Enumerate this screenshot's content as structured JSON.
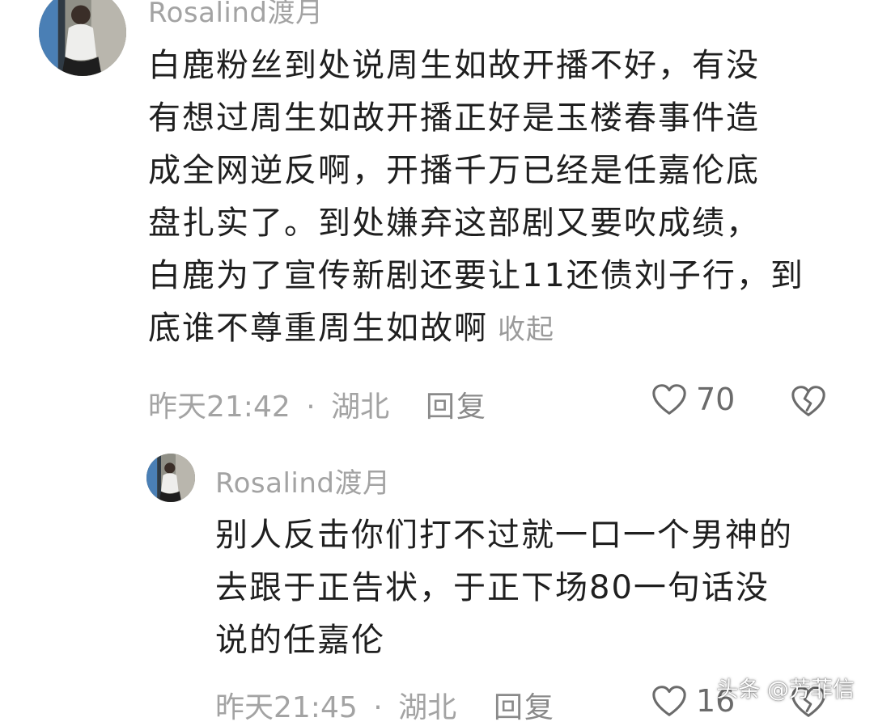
{
  "comments": [
    {
      "username": "Rosalind渡月",
      "lines": [
        "白鹿粉丝到处说周生如故开播不好，有没",
        "有想过周生如故开播正好是玉楼春事件造",
        "成全网逆反啊，开播千万已经是任嘉伦底",
        "盘扎实了。到处嫌弃这部剧又要吹成绩，",
        "白鹿为了宣传新剧还要让11还债刘子行，到",
        "底谁不尊重周生如故啊"
      ],
      "collapse_label": "收起",
      "time": "昨天21:42",
      "separator": "·",
      "location": "湖北",
      "reply_label": "回复",
      "likes": "70"
    },
    {
      "username": "Rosalind渡月",
      "lines": [
        "别人反击你们打不过就一口一个男神的",
        "去跟于正告状，于正下场80一句话没",
        "说的任嘉伦"
      ],
      "time": "昨天21:45",
      "separator": "·",
      "location": "湖北",
      "reply_label": "回复",
      "likes": "16"
    }
  ],
  "icons": {
    "like": "heart-outline-icon",
    "dislike": "broken-heart-icon"
  },
  "watermark": "头条 @芳菲信",
  "colors": {
    "text": "#1f1f1f",
    "meta": "#a3a3a3",
    "icon": "#6b6b6b"
  }
}
